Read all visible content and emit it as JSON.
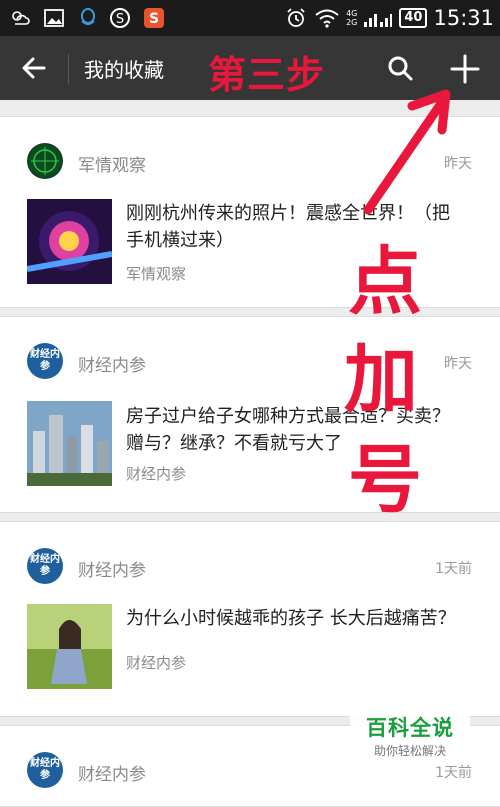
{
  "status_bar": {
    "time": "15:31",
    "battery": "40",
    "network_top": "4G",
    "network_bottom": "2G"
  },
  "header": {
    "title": "我的收藏",
    "annotation_step": "第三步"
  },
  "items": [
    {
      "source": "军情观察",
      "time": "昨天",
      "headline": "刚刚杭州传来的照片！震感全世界！（把手机横过来）",
      "sub": "军情观察",
      "avatar_text": ""
    },
    {
      "source": "财经内参",
      "time": "昨天",
      "headline": "房子过户给子女哪种方式最合适？买卖？赠与？继承？不看就亏大了",
      "sub": "财经内参",
      "avatar_text": "财经内参"
    },
    {
      "source": "财经内参",
      "time": "1天前",
      "headline": "为什么小时候越乖的孩子 长大后越痛苦？",
      "sub": "财经内参",
      "avatar_text": "财经内参"
    },
    {
      "source": "财经内参",
      "time": "1天前",
      "headline": "",
      "sub": "",
      "avatar_text": "财经内参"
    }
  ],
  "annotation": {
    "chars": [
      "点",
      "加",
      "号"
    ]
  },
  "watermark": {
    "title": "百科全说",
    "subtitle": "助你轻松解决"
  },
  "colors": {
    "header_bg": "#363636",
    "annotation_red": "#e8173b",
    "watermark_green": "#1b9e3e"
  }
}
